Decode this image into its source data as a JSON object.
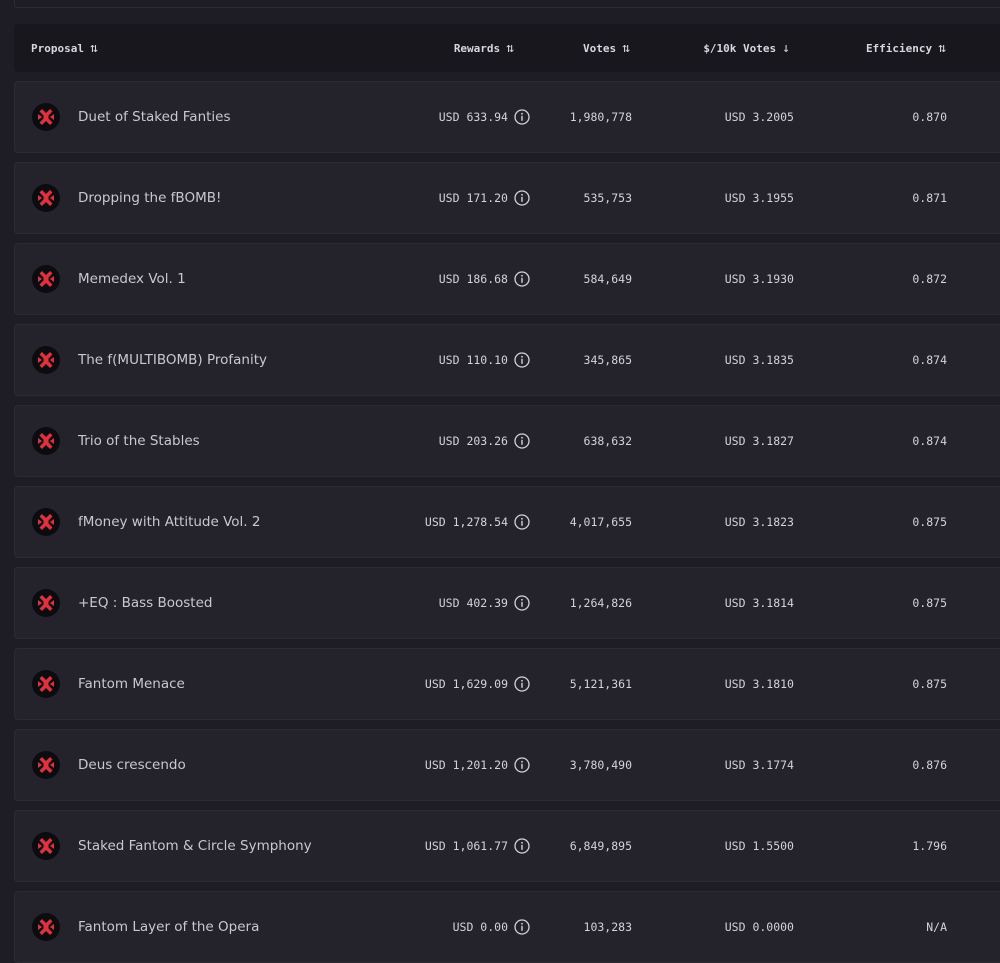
{
  "header": {
    "proposal": "Proposal",
    "rewards": "Rewards",
    "votes": "Votes",
    "per10k": "$/10k Votes",
    "efficiency": "Efficiency"
  },
  "rows": [
    {
      "name": "Duet of Staked Fanties",
      "rewards": "USD 633.94",
      "votes": "1,980,778",
      "per10k": "USD 3.2005",
      "efficiency": "0.870"
    },
    {
      "name": "Dropping the fBOMB!",
      "rewards": "USD 171.20",
      "votes": "535,753",
      "per10k": "USD 3.1955",
      "efficiency": "0.871"
    },
    {
      "name": "Memedex Vol. 1",
      "rewards": "USD 186.68",
      "votes": "584,649",
      "per10k": "USD 3.1930",
      "efficiency": "0.872"
    },
    {
      "name": "The f(MULTIBOMB) Profanity",
      "rewards": "USD 110.10",
      "votes": "345,865",
      "per10k": "USD 3.1835",
      "efficiency": "0.874"
    },
    {
      "name": "Trio of the Stables",
      "rewards": "USD 203.26",
      "votes": "638,632",
      "per10k": "USD 3.1827",
      "efficiency": "0.874"
    },
    {
      "name": "fMoney with Attitude Vol. 2",
      "rewards": "USD 1,278.54",
      "votes": "4,017,655",
      "per10k": "USD 3.1823",
      "efficiency": "0.875"
    },
    {
      "name": "+EQ : Bass Boosted",
      "rewards": "USD 402.39",
      "votes": "1,264,826",
      "per10k": "USD 3.1814",
      "efficiency": "0.875"
    },
    {
      "name": "Fantom Menace",
      "rewards": "USD 1,629.09",
      "votes": "5,121,361",
      "per10k": "USD 3.1810",
      "efficiency": "0.875"
    },
    {
      "name": "Deus crescendo",
      "rewards": "USD 1,201.20",
      "votes": "3,780,490",
      "per10k": "USD 3.1774",
      "efficiency": "0.876"
    },
    {
      "name": "Staked Fantom & Circle Symphony",
      "rewards": "USD 1,061.77",
      "votes": "6,849,895",
      "per10k": "USD 1.5500",
      "efficiency": "1.796"
    },
    {
      "name": "Fantom Layer of the Opera",
      "rewards": "USD 0.00",
      "votes": "103,283",
      "per10k": "USD 0.0000",
      "efficiency": "N/A"
    }
  ]
}
